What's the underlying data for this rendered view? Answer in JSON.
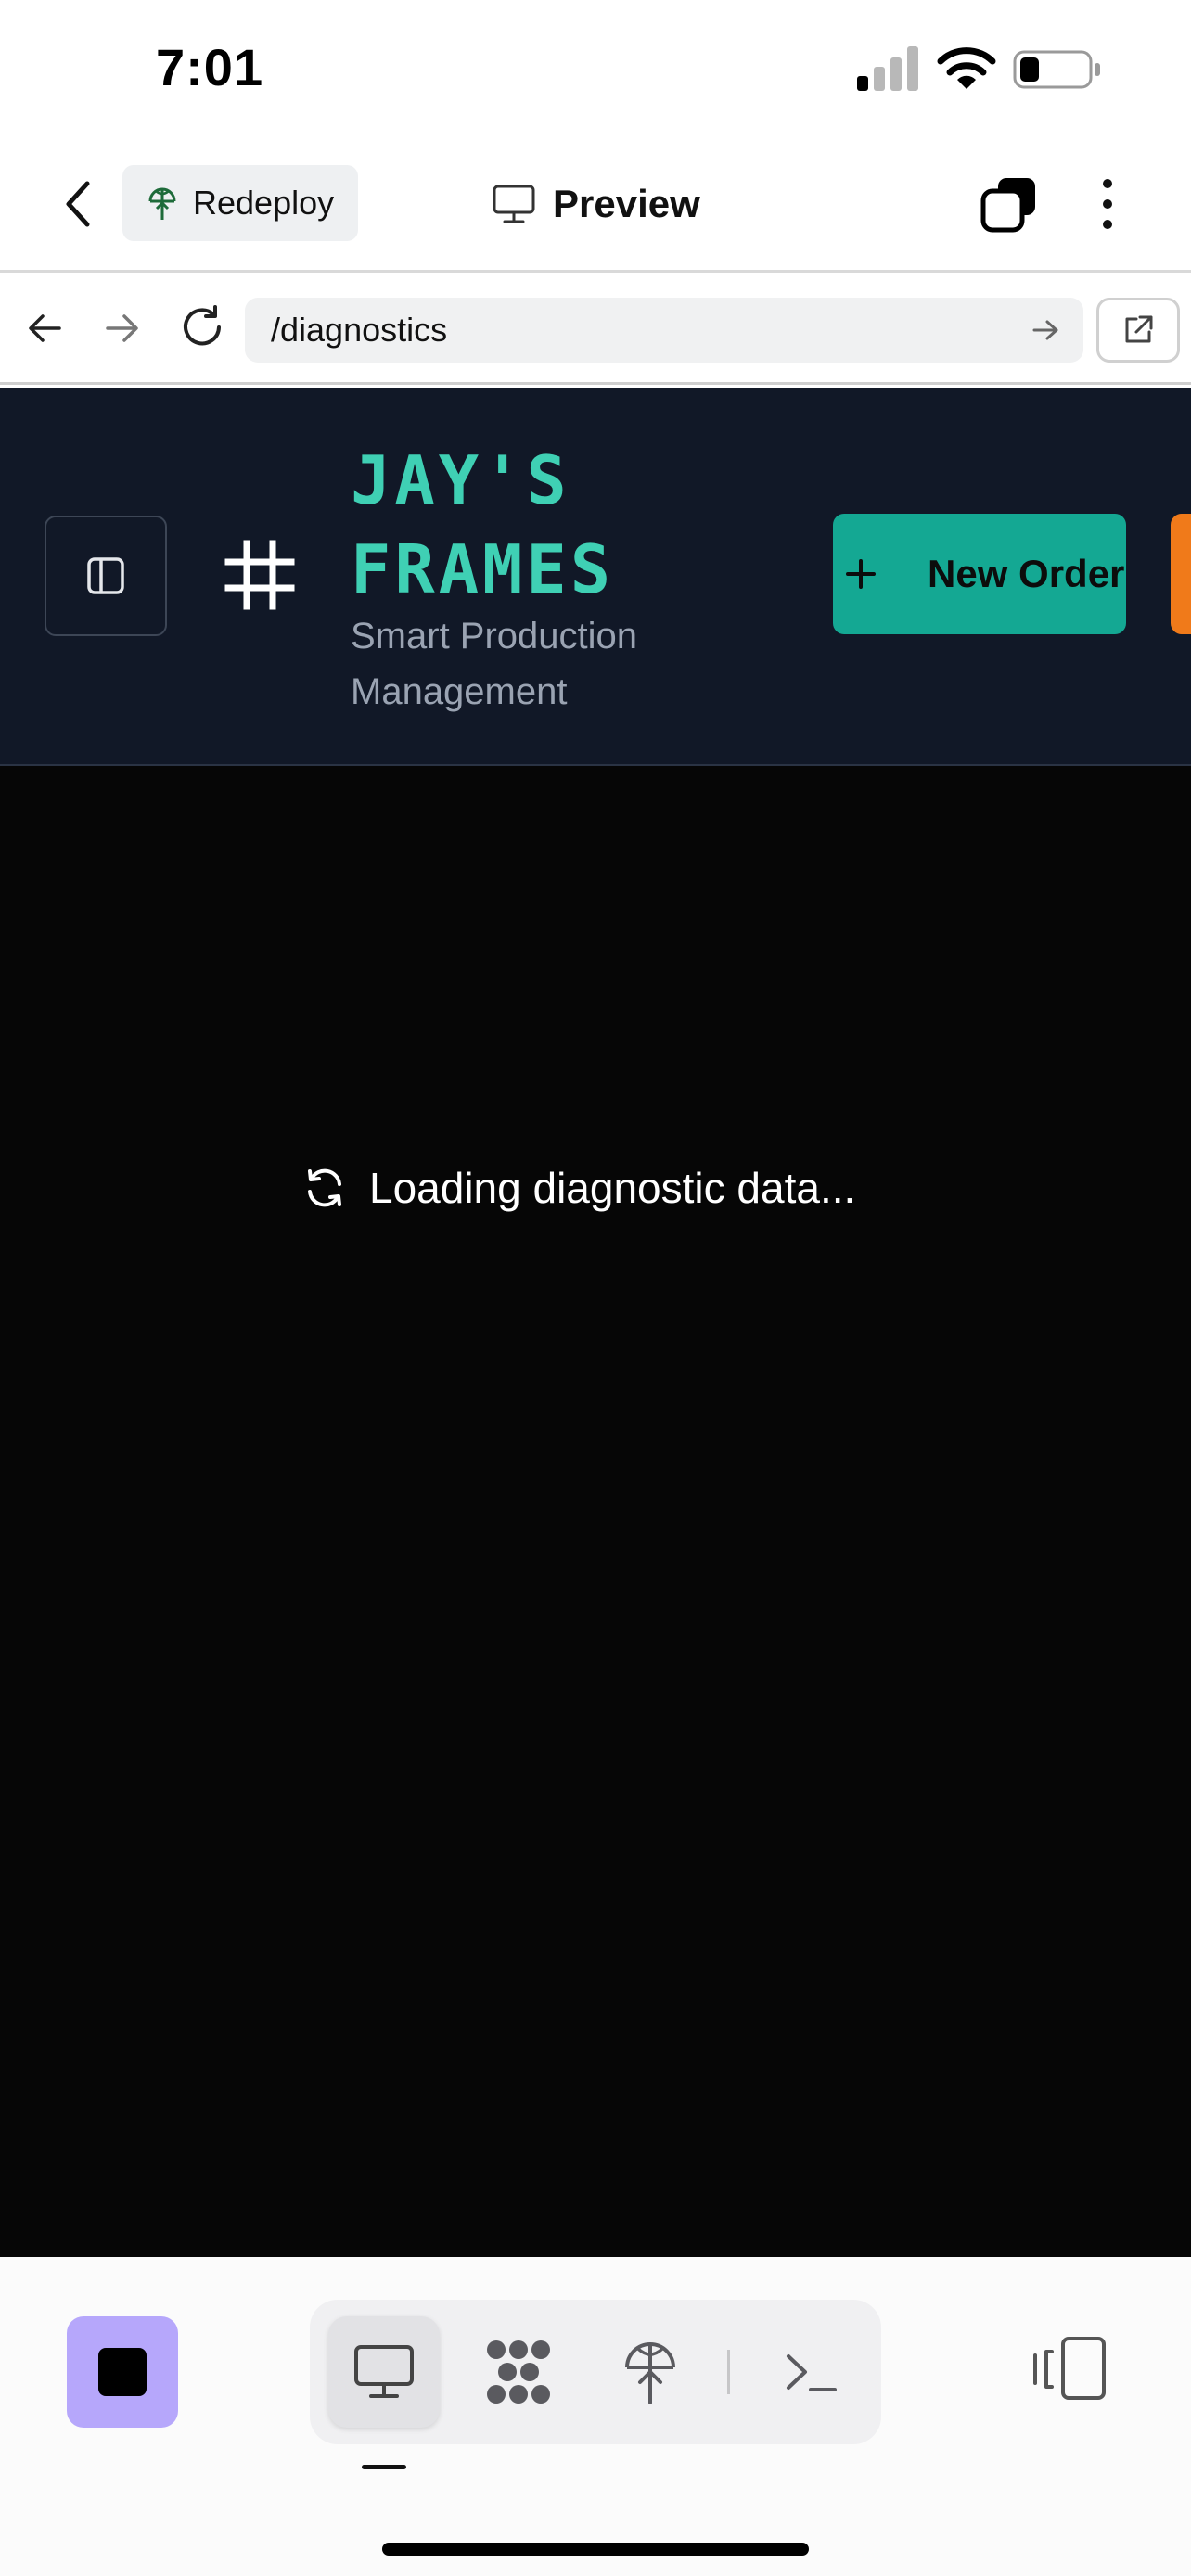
{
  "status_bar": {
    "time": "7:01"
  },
  "header": {
    "redeploy_label": "Redeploy",
    "title": "Preview",
    "icons": [
      "back-chevron-icon",
      "redeploy-icon",
      "monitor-icon",
      "tabs-icon",
      "more-vertical-icon"
    ]
  },
  "browser": {
    "url": "/diagnostics",
    "icons": [
      "arrow-left-icon",
      "arrow-right-icon",
      "reload-icon",
      "url-go-icon",
      "open-external-icon"
    ]
  },
  "site": {
    "brand_title": "JAY'S FRAMES",
    "brand_subtitle": "Smart Production Management",
    "new_order_label": "New Order",
    "colors": {
      "header_bg": "#111827",
      "brand": "#3fd0b4",
      "primary_btn": "#14a893",
      "accent_btn": "#f07a1a"
    }
  },
  "main": {
    "loading_text": "Loading diagnostic data..."
  },
  "toolbar": {
    "modes": [
      "desktop-icon",
      "workflow-icon",
      "deploy-icon",
      "shell-icon"
    ],
    "active_mode": "desktop",
    "colors": {
      "stop_button": "#b6a7fb"
    }
  }
}
